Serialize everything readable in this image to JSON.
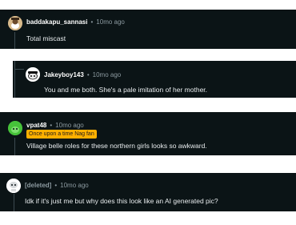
{
  "comments": [
    {
      "author": "baddakapu_sannasi",
      "separator": "•",
      "time": "10mo ago",
      "body": "Total miscast",
      "avatar_icon": "snoo-avatar-icon"
    },
    {
      "author": "Jakeyboy143",
      "separator": "•",
      "time": "10mo ago",
      "body": "You and me both. She's a pale imitation of her mother.",
      "avatar_icon": "snoo-avatar-icon"
    },
    {
      "author": "vpat48",
      "separator": "•",
      "time": "10mo ago",
      "flair": "Once upon a time Nag fan",
      "body": "Village belle roles for these northern girls looks so awkward.",
      "avatar_icon": "snoo-avatar-icon"
    },
    {
      "author": "[deleted]",
      "separator": "•",
      "time": "10mo ago",
      "body": "Idk if it's just me but why does this look like an AI generated pic?",
      "avatar_icon": "snoo-avatar-icon"
    }
  ],
  "colors": {
    "card_bg": "#0b1416",
    "flair_bg": "#ffb000",
    "text": "#e8ecee",
    "muted": "#8c9aa0"
  }
}
